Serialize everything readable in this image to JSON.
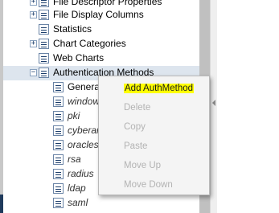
{
  "tree": {
    "items": [
      {
        "label": "File Descriptor Properties",
        "icon": "node-icon",
        "toggle": "+",
        "italic": false
      },
      {
        "label": "File Display Columns",
        "icon": "node-icon",
        "toggle": "+",
        "italic": false
      },
      {
        "label": "Statistics",
        "icon": "node-icon",
        "toggle": "",
        "italic": false
      },
      {
        "label": "Chart Categories",
        "icon": "node-icon",
        "toggle": "+",
        "italic": false
      },
      {
        "label": "Web Charts",
        "icon": "node-icon",
        "toggle": "",
        "italic": false
      },
      {
        "label": "Authentication Methods",
        "icon": "node-icon",
        "toggle": "−",
        "italic": false,
        "selected": true
      },
      {
        "label": "General",
        "icon": "node-icon",
        "toggle": "",
        "italic": false
      },
      {
        "label": "windows",
        "icon": "node-icon",
        "toggle": "",
        "italic": true
      },
      {
        "label": "pki",
        "icon": "node-icon",
        "toggle": "",
        "italic": true
      },
      {
        "label": "cyberark",
        "icon": "node-icon",
        "toggle": "",
        "italic": true
      },
      {
        "label": "oraclesso",
        "icon": "node-icon",
        "toggle": "",
        "italic": true
      },
      {
        "label": "rsa",
        "icon": "node-icon",
        "toggle": "",
        "italic": true
      },
      {
        "label": "radius",
        "icon": "node-icon",
        "toggle": "",
        "italic": true
      },
      {
        "label": "ldap",
        "icon": "node-icon",
        "toggle": "",
        "italic": true
      },
      {
        "label": "saml",
        "icon": "node-icon",
        "toggle": "",
        "italic": true
      }
    ]
  },
  "context_menu": {
    "items": [
      {
        "label": "Add AuthMethod",
        "enabled": true,
        "highlighted": true
      },
      {
        "label": "Delete",
        "enabled": false
      },
      {
        "label": "Copy",
        "enabled": false
      },
      {
        "label": "Paste",
        "enabled": false
      },
      {
        "label": "Move Up",
        "enabled": false
      },
      {
        "label": "Move Down",
        "enabled": false
      }
    ]
  },
  "colors": {
    "selection": "#dde5ee",
    "highlight": "#ffff00",
    "disabled_text": "#b3b3b3",
    "icon_border": "#6a84a6"
  }
}
